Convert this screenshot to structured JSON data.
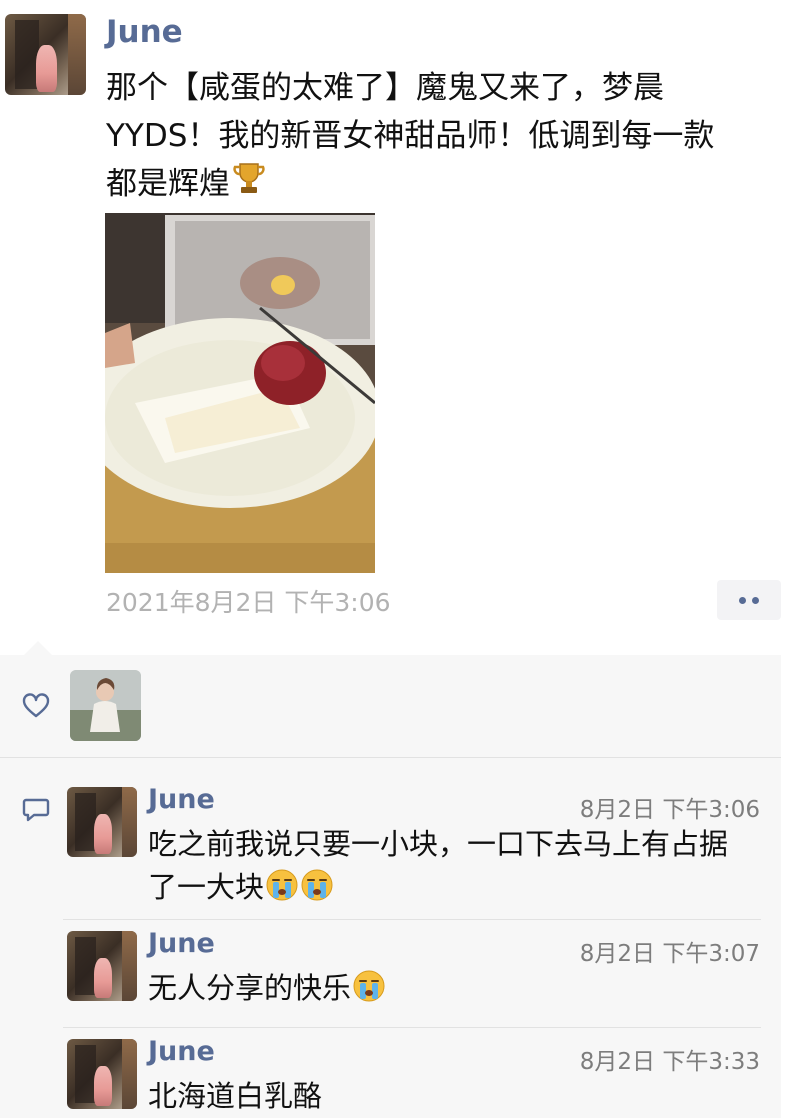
{
  "post": {
    "author": "June",
    "text_line1": "那个【咸蛋的太难了】魔鬼又来了，梦晨",
    "text_line2": "YYDS！我的新晋女神甜品师！低调到每一款",
    "text_line3": "都是辉煌",
    "text_emoji": "trophy-emoji",
    "timestamp": "2021年8月2日 下午3:06",
    "more_icon": "more-dots-icon"
  },
  "likes": {
    "icon": "heart-icon"
  },
  "comments": [
    {
      "author": "June",
      "time": "8月2日 下午3:06",
      "text_line1": "吃之前我说只要一小块，一口下去马上有占据",
      "text_line2": "了一大块",
      "emoji": "crying-emoji"
    },
    {
      "author": "June",
      "time": "8月2日 下午3:07",
      "text_line1": "无人分享的快乐",
      "emoji": "crying-emoji"
    },
    {
      "author": "June",
      "time": "8月2日 下午3:33",
      "text_line1": "北海道白乳酪"
    }
  ],
  "comment_icon": "comment-bubble-icon",
  "colors": {
    "name_blue": "#576b95",
    "panel_bg": "#f7f7f7",
    "meta_gray": "#b2b2b2"
  }
}
